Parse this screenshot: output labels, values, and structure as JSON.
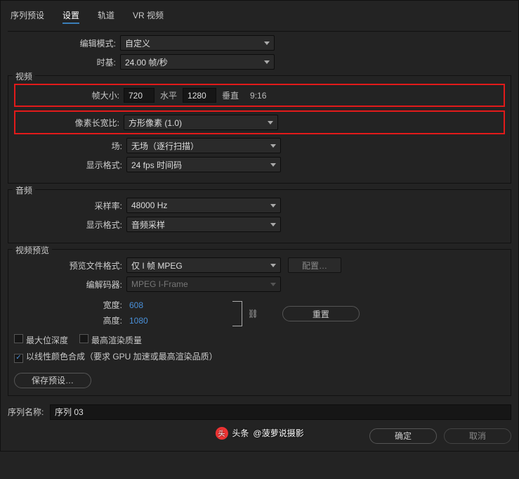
{
  "tabs": {
    "preset": "序列预设",
    "settings": "设置",
    "tracks": "轨道",
    "vr": "VR 视频"
  },
  "topRow": {
    "editModeLabel": "编辑模式:",
    "editModeValue": "自定义",
    "timebaseLabel": "时基:",
    "timebaseValue": "24.00 帧/秒"
  },
  "video": {
    "legend": "视频",
    "frameSizeLabel": "帧大小:",
    "fw": "720",
    "horizTxt": "水平",
    "fh": "1280",
    "vertTxt": "垂直",
    "ratio": "9:16",
    "pixelAspectLabel": "像素长宽比:",
    "pixelAspectValue": "方形像素 (1.0)",
    "fieldsLabel": "场:",
    "fieldsValue": "无场（逐行扫描）",
    "dispFmtLabel": "显示格式:",
    "dispFmtValue": "24 fps 时间码"
  },
  "audio": {
    "legend": "音频",
    "sampleRateLabel": "采样率:",
    "sampleRateValue": "48000 Hz",
    "dispFmtLabel": "显示格式:",
    "dispFmtValue": "音频采样"
  },
  "preview": {
    "legend": "视频预览",
    "fileFmtLabel": "预览文件格式:",
    "fileFmtValue": "仅 I 帧 MPEG",
    "configBtn": "配置…",
    "codecLabel": "编解码器:",
    "codecValue": "MPEG I-Frame",
    "widthLabel": "宽度:",
    "widthValue": "608",
    "heightLabel": "高度:",
    "heightValue": "1080",
    "resetBtn": "重置",
    "maxDepth": "最大位深度",
    "maxRender": "最高渲染质量",
    "linear": "以线性颜色合成（要求 GPU 加速或最高渲染品质）",
    "savePreset": "保存预设…"
  },
  "nameRow": {
    "label": "序列名称:",
    "value": "序列 03"
  },
  "footer": {
    "ok": "确定",
    "cancel": "取消"
  },
  "watermark": {
    "brand": "头条",
    "handle": "@菠萝说摄影"
  }
}
